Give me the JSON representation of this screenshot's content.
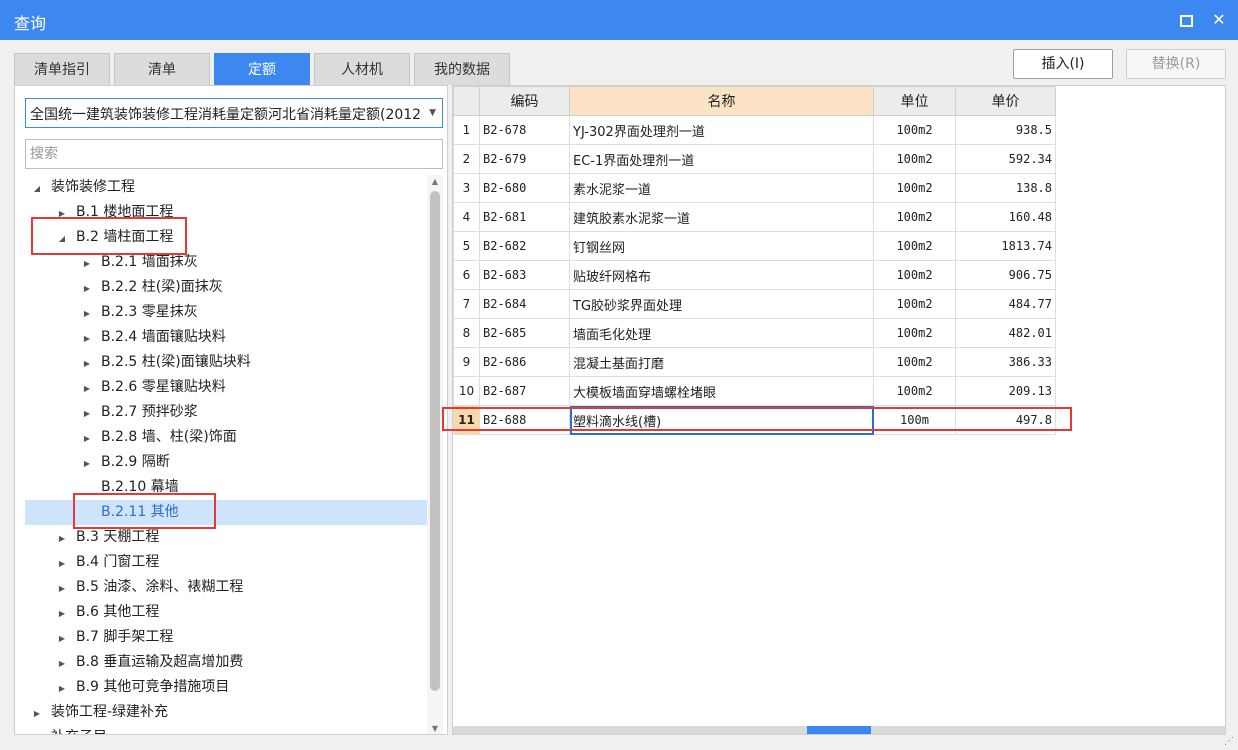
{
  "window": {
    "title": "查询",
    "maximize_icon": "maximize-icon",
    "close_icon": "close-icon",
    "close_glyph": "✕"
  },
  "tabs": [
    {
      "label": "清单指引",
      "active": false
    },
    {
      "label": "清单",
      "active": false
    },
    {
      "label": "定额",
      "active": true
    },
    {
      "label": "人材机",
      "active": false
    },
    {
      "label": "我的数据",
      "active": false
    }
  ],
  "toolbar": {
    "insert_label": "插入(I)",
    "replace_label": "替换(R)"
  },
  "left": {
    "library": "全国统一建筑装饰装修工程消耗量定额河北省消耗量定额(2012)",
    "search_placeholder": "搜索",
    "tree": [
      {
        "label": "装饰装修工程",
        "level": 0,
        "expanded": true,
        "has_children": true
      },
      {
        "label": "B.1 楼地面工程",
        "level": 1,
        "expanded": false,
        "has_children": true
      },
      {
        "label": "B.2 墙柱面工程",
        "level": 1,
        "expanded": true,
        "has_children": true
      },
      {
        "label": "B.2.1 墙面抹灰",
        "level": 2,
        "expanded": false,
        "has_children": true
      },
      {
        "label": "B.2.2 柱(梁)面抹灰",
        "level": 2,
        "expanded": false,
        "has_children": true
      },
      {
        "label": "B.2.3 零星抹灰",
        "level": 2,
        "expanded": false,
        "has_children": true
      },
      {
        "label": "B.2.4 墙面镶贴块料",
        "level": 2,
        "expanded": false,
        "has_children": true
      },
      {
        "label": "B.2.5 柱(梁)面镶贴块料",
        "level": 2,
        "expanded": false,
        "has_children": true
      },
      {
        "label": "B.2.6 零星镶贴块料",
        "level": 2,
        "expanded": false,
        "has_children": true
      },
      {
        "label": "B.2.7 预拌砂浆",
        "level": 2,
        "expanded": false,
        "has_children": true
      },
      {
        "label": "B.2.8 墙、柱(梁)饰面",
        "level": 2,
        "expanded": false,
        "has_children": true
      },
      {
        "label": "B.2.9 隔断",
        "level": 2,
        "expanded": false,
        "has_children": true
      },
      {
        "label": "B.2.10 幕墙",
        "level": 2,
        "expanded": false,
        "has_children": false
      },
      {
        "label": "B.2.11 其他",
        "level": 2,
        "expanded": false,
        "has_children": false,
        "selected": true
      },
      {
        "label": "B.3 天棚工程",
        "level": 1,
        "expanded": false,
        "has_children": true
      },
      {
        "label": "B.4 门窗工程",
        "level": 1,
        "expanded": false,
        "has_children": true
      },
      {
        "label": "B.5 油漆、涂料、裱糊工程",
        "level": 1,
        "expanded": false,
        "has_children": true
      },
      {
        "label": "B.6 其他工程",
        "level": 1,
        "expanded": false,
        "has_children": true
      },
      {
        "label": "B.7 脚手架工程",
        "level": 1,
        "expanded": false,
        "has_children": true
      },
      {
        "label": "B.8 垂直运输及超高增加费",
        "level": 1,
        "expanded": false,
        "has_children": true
      },
      {
        "label": "B.9 其他可竞争措施项目",
        "level": 1,
        "expanded": false,
        "has_children": true
      },
      {
        "label": "装饰工程-绿建补充",
        "level": 0,
        "expanded": false,
        "has_children": true
      },
      {
        "label": "补充子目",
        "level": 0,
        "expanded": false,
        "has_children": true
      }
    ]
  },
  "grid": {
    "headers": {
      "code": "编码",
      "name": "名称",
      "unit": "单位",
      "price": "单价"
    },
    "rows": [
      {
        "num": "1",
        "code": "B2-678",
        "name": "YJ-302界面处理剂一道",
        "unit": "100m2",
        "price": "938.5"
      },
      {
        "num": "2",
        "code": "B2-679",
        "name": "EC-1界面处理剂一道",
        "unit": "100m2",
        "price": "592.34"
      },
      {
        "num": "3",
        "code": "B2-680",
        "name": "素水泥浆一道",
        "unit": "100m2",
        "price": "138.8"
      },
      {
        "num": "4",
        "code": "B2-681",
        "name": "建筑胶素水泥浆一道",
        "unit": "100m2",
        "price": "160.48"
      },
      {
        "num": "5",
        "code": "B2-682",
        "name": "钉钢丝网",
        "unit": "100m2",
        "price": "1813.74"
      },
      {
        "num": "6",
        "code": "B2-683",
        "name": "贴玻纤网格布",
        "unit": "100m2",
        "price": "906.75"
      },
      {
        "num": "7",
        "code": "B2-684",
        "name": "TG胶砂浆界面处理",
        "unit": "100m2",
        "price": "484.77"
      },
      {
        "num": "8",
        "code": "B2-685",
        "name": "墙面毛化处理",
        "unit": "100m2",
        "price": "482.01"
      },
      {
        "num": "9",
        "code": "B2-686",
        "name": "混凝土基面打磨",
        "unit": "100m2",
        "price": "386.33"
      },
      {
        "num": "10",
        "code": "B2-687",
        "name": "大模板墙面穿墙螺栓堵眼",
        "unit": "100m2",
        "price": "209.13"
      },
      {
        "num": "11",
        "code": "B2-688",
        "name": "塑料滴水线(槽)",
        "unit": "100m",
        "price": "497.8",
        "active": true
      }
    ]
  },
  "colors": {
    "accent": "#3d88f0",
    "annotation_red": "#e53935",
    "selected_tree_bg": "#cde4fb",
    "name_header_bg": "#fde3c6"
  }
}
